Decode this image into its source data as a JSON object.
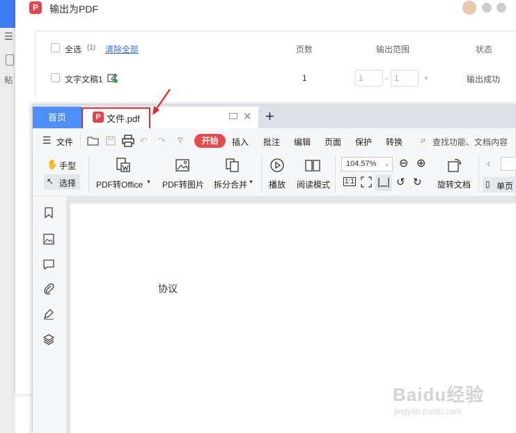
{
  "background_app": {
    "paste_label": "粘"
  },
  "dialog": {
    "logo": "P",
    "title": "输出为PDF",
    "table": {
      "select_all_label": "全选",
      "selected_count": "(1)",
      "clear_all": "清除全部",
      "col_pages": "页数",
      "col_range": "输出范围",
      "col_status": "状态",
      "rows": [
        {
          "name": "文字文稿1",
          "pages": "1",
          "range_from": "1",
          "range_dash": "-",
          "range_to": "1",
          "status": "输出成功"
        }
      ]
    }
  },
  "editor": {
    "tabs": {
      "home": "首页",
      "file": "文件.pdf"
    },
    "menu": {
      "file": "文件",
      "items": [
        "开始",
        "插入",
        "批注",
        "编辑",
        "页面",
        "保护",
        "转换"
      ],
      "search_placeholder": "查找功能、文档内容"
    },
    "ribbon": {
      "hand": "手型",
      "select": "选择",
      "pdf_to_office": "PDF转Office",
      "pdf_to_image": "PDF转图片",
      "split_merge": "拆分合并",
      "play": "播放",
      "read_mode": "阅读模式",
      "zoom": "104.57%",
      "rotate_doc": "旋转文档",
      "single_page": "单页",
      "actual_size": "1:1"
    },
    "document": {
      "text": "协议"
    }
  },
  "watermark": {
    "main": "Baidu经验",
    "sub": "jingyan.baidu.com"
  },
  "colors": {
    "accent_blue": "#4e8ef7",
    "start_red": "#e74a4d",
    "highlight_red": "#e52a2a",
    "pdf_red": "#e8424c",
    "success_green": "#2daa4f"
  }
}
